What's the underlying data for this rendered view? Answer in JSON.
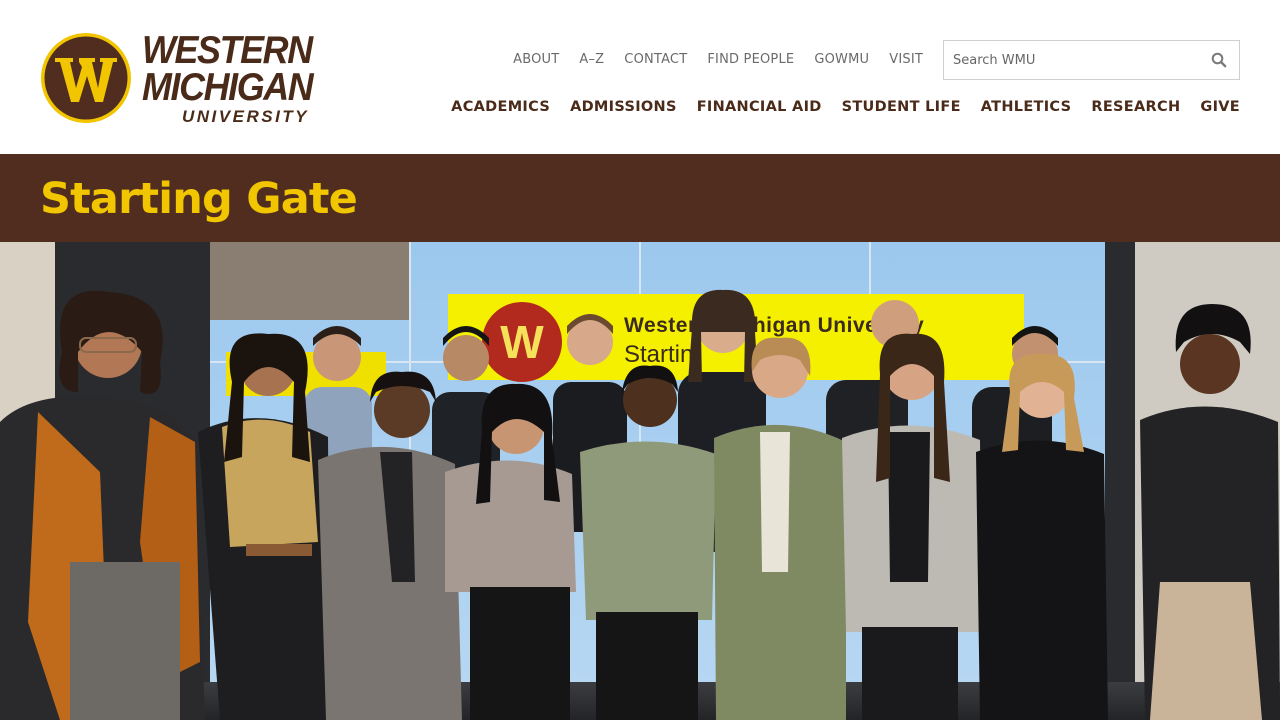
{
  "brand": {
    "line1": "Western",
    "line2": "Michigan",
    "line3": "University",
    "seal_letter": "W",
    "colors": {
      "brown": "#512d1f",
      "gold": "#f1c500",
      "text_brown": "#4a2a18"
    }
  },
  "utility_nav": [
    {
      "label": "ABOUT"
    },
    {
      "label": "A–Z"
    },
    {
      "label": "CONTACT"
    },
    {
      "label": "FIND PEOPLE"
    },
    {
      "label": "GOWMU"
    },
    {
      "label": "VISIT"
    }
  ],
  "search": {
    "placeholder": "Search WMU",
    "value": "",
    "icon": "search-icon"
  },
  "main_nav": [
    {
      "label": "ACADEMICS"
    },
    {
      "label": "ADMISSIONS"
    },
    {
      "label": "FINANCIAL AID"
    },
    {
      "label": "STUDENT LIFE"
    },
    {
      "label": "ATHLETICS"
    },
    {
      "label": "RESEARCH"
    },
    {
      "label": "GIVE"
    }
  ],
  "page": {
    "title": "Starting Gate"
  },
  "hero": {
    "screen_text_1": "Western Michigan University",
    "screen_text_2": "Startin",
    "screen_letter": "W"
  }
}
